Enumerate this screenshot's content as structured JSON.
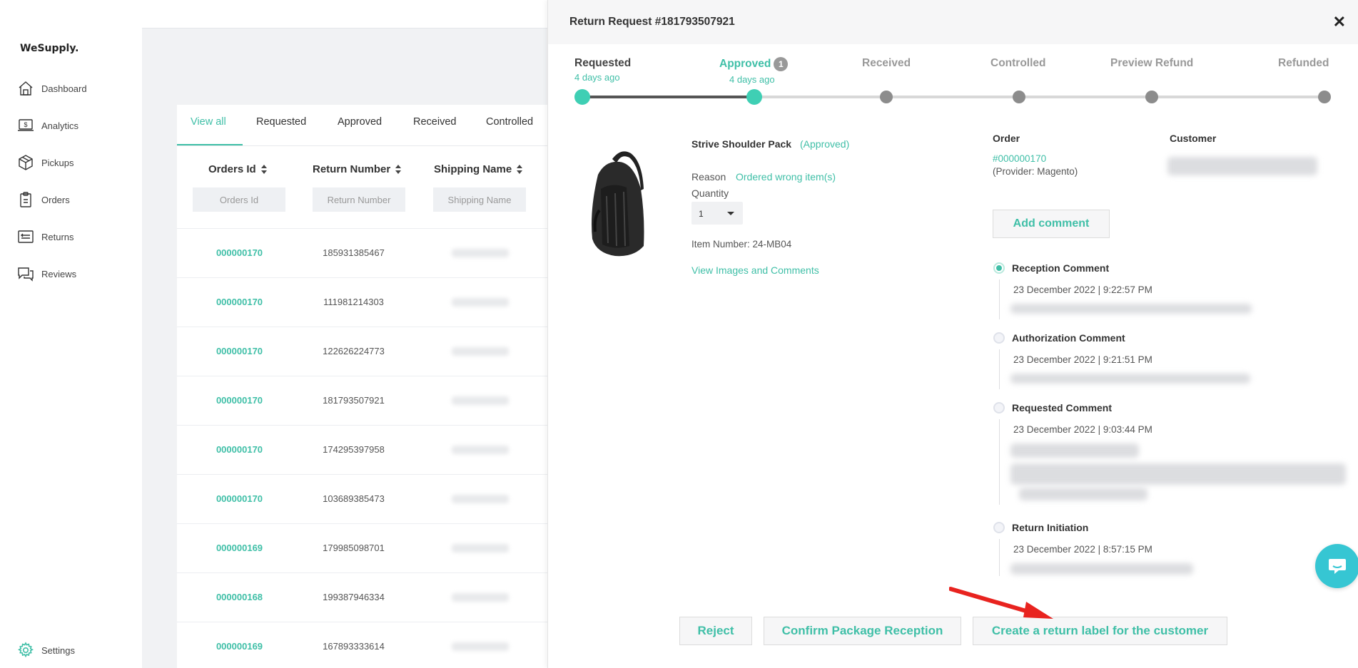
{
  "brand": "WeSupply.",
  "sidebar": {
    "items": [
      {
        "label": "Dashboard",
        "icon": "home-icon"
      },
      {
        "label": "Analytics",
        "icon": "analytics-icon"
      },
      {
        "label": "Pickups",
        "icon": "box-icon"
      },
      {
        "label": "Orders",
        "icon": "clipboard-icon"
      },
      {
        "label": "Returns",
        "icon": "returns-icon"
      },
      {
        "label": "Reviews",
        "icon": "reviews-icon"
      }
    ],
    "settings": "Settings"
  },
  "list": {
    "tabs": [
      "View all",
      "Requested",
      "Approved",
      "Received",
      "Controlled"
    ],
    "active_tab": "View all",
    "columns": [
      "Orders Id",
      "Return Number",
      "Shipping Name"
    ],
    "filters": [
      "Orders Id",
      "Return Number",
      "Shipping Name"
    ],
    "rows": [
      {
        "order": "000000170",
        "return_number": "185931385467"
      },
      {
        "order": "000000170",
        "return_number": "111981214303"
      },
      {
        "order": "000000170",
        "return_number": "122626224773"
      },
      {
        "order": "000000170",
        "return_number": "181793507921"
      },
      {
        "order": "000000170",
        "return_number": "174295397958"
      },
      {
        "order": "000000170",
        "return_number": "103689385473"
      },
      {
        "order": "000000169",
        "return_number": "179985098701"
      },
      {
        "order": "000000168",
        "return_number": "199387946334"
      },
      {
        "order": "000000169",
        "return_number": "167893333614"
      }
    ]
  },
  "modal": {
    "title": "Return Request #181793507921",
    "steps": [
      {
        "label": "Requested",
        "sub": "4 days ago"
      },
      {
        "label": "Approved",
        "sub": "4 days ago",
        "badge": "1"
      },
      {
        "label": "Received"
      },
      {
        "label": "Controlled"
      },
      {
        "label": "Preview Refund"
      },
      {
        "label": "Refunded"
      }
    ],
    "current_step": 1,
    "product": {
      "name": "Strive Shoulder Pack",
      "status": "(Approved)",
      "reason_label": "Reason",
      "reason": "Ordered wrong item(s)",
      "quantity_label": "Quantity",
      "quantity": "1",
      "item_number": "Item Number: 24-MB04",
      "view_link": "View Images and Comments"
    },
    "order_label": "Order",
    "order_number": "#000000170",
    "order_provider": "(Provider: Magento)",
    "customer_label": "Customer",
    "add_comment": "Add comment",
    "timeline": [
      {
        "title": "Reception Comment",
        "date": "23 December 2022 | 9:22:57 PM",
        "active": true
      },
      {
        "title": "Authorization Comment",
        "date": "23 December 2022 | 9:21:51 PM",
        "active": false
      },
      {
        "title": "Requested Comment",
        "date": "23 December 2022 | 9:03:44 PM",
        "active": false
      },
      {
        "title": "Return Initiation",
        "date": "23 December 2022 | 8:57:15 PM",
        "active": false
      }
    ],
    "buttons": {
      "reject": "Reject",
      "confirm": "Confirm Package Reception",
      "create_label": "Create a return label for the customer"
    }
  },
  "colors": {
    "accent": "#3fbfa7",
    "annotation_arrow": "#e8231f",
    "chat": "#36c6d3"
  }
}
